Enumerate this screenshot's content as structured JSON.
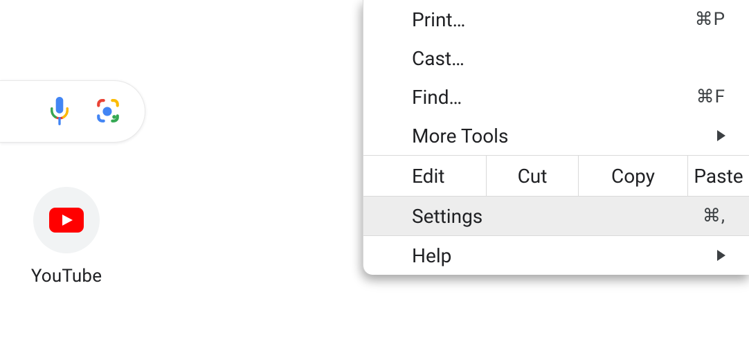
{
  "search": {
    "mic_icon": "microphone-icon",
    "lens_icon": "camera-lens-icon"
  },
  "shortcut": {
    "label": "YouTube",
    "icon": "youtube-icon"
  },
  "menu": {
    "items_top": [
      {
        "label": "Print…",
        "shortcut": "⌘P",
        "submenu": false
      },
      {
        "label": "Cast…",
        "shortcut": "",
        "submenu": false
      },
      {
        "label": "Find…",
        "shortcut": "⌘F",
        "submenu": false
      },
      {
        "label": "More Tools",
        "shortcut": "",
        "submenu": true
      }
    ],
    "edit_row": {
      "label": "Edit",
      "actions": [
        "Cut",
        "Copy",
        "Paste"
      ]
    },
    "items_bottom": [
      {
        "label": "Settings",
        "shortcut": "⌘,",
        "submenu": false,
        "highlight": true
      },
      {
        "label": "Help",
        "shortcut": "",
        "submenu": true,
        "highlight": false
      }
    ]
  }
}
